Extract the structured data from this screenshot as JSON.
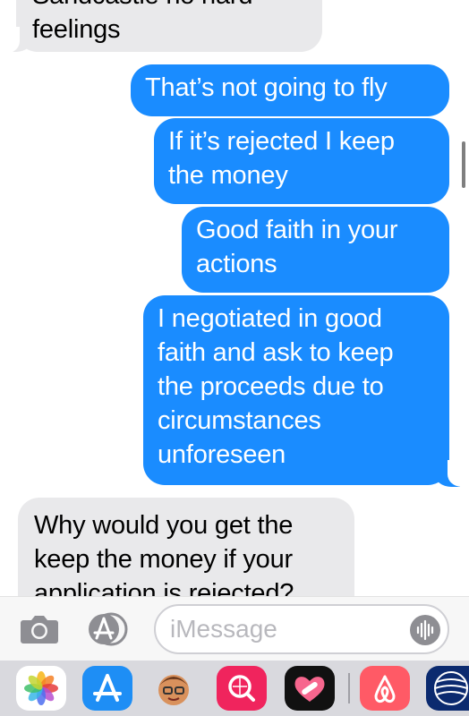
{
  "messages": [
    {
      "direction": "incoming",
      "text": "Sandcastle no hard\nfeelings"
    },
    {
      "direction": "outgoing",
      "text": "That’s not going to fly"
    },
    {
      "direction": "outgoing",
      "text": "If it’s rejected I keep\nthe money"
    },
    {
      "direction": "outgoing",
      "text": "Good faith in your\nactions"
    },
    {
      "direction": "outgoing",
      "text": "I negotiated in good\nfaith and ask to keep\nthe proceeds due to\ncircumstances\nunforeseen"
    },
    {
      "direction": "incoming",
      "text": "Why would you get the\nkeep the money if your\napplication is rejected?"
    }
  ],
  "composer": {
    "placeholder": "iMessage",
    "camera_icon": "camera-icon",
    "apps_icon": "app-store-icon",
    "audio_icon": "audio-waveform-icon"
  },
  "app_drawer": {
    "apps": [
      "Photos",
      "App Store",
      "Memoji",
      "Search",
      "Heart App",
      "Airbnb",
      "United"
    ]
  },
  "colors": {
    "outgoing": "#1a8cff",
    "incoming": "#e9e9eb",
    "background": "#ffffff"
  }
}
